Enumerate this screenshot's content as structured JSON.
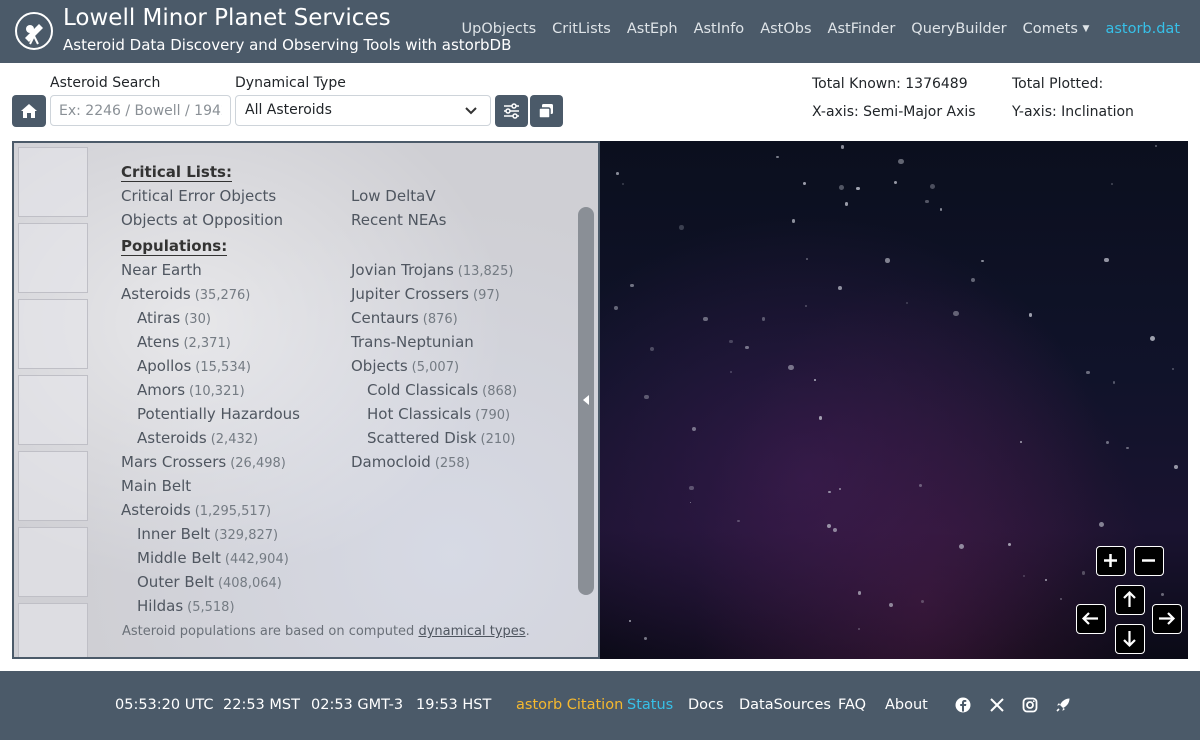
{
  "header": {
    "title": "Lowell Minor Planet Services",
    "subtitle": "Asteroid Data Discovery and Observing Tools with astorbDB",
    "logo_icon": "telescope-logo-icon",
    "nav": [
      "UpObjects",
      "CritLists",
      "AstEph",
      "AstInfo",
      "AstObs",
      "AstFinder",
      "QueryBuilder",
      "Comets"
    ],
    "active_nav": "astorb.dat",
    "accent_color": "#37c0e8",
    "bar_color": "#4b5a69"
  },
  "controls": {
    "search_label": "Asteroid Search",
    "search_placeholder": "Ex: 2246 / Bowell / 1942 CD",
    "dyn_label": "Dynamical Type",
    "dyn_value": "All Asteroids"
  },
  "stats": {
    "total_known": "Total Known: 1376489",
    "total_plotted": "Total Plotted:",
    "x_axis": "X-axis: Semi-Major Axis",
    "y_axis": "Y-axis: Inclination"
  },
  "panel": {
    "critical_heading": "Critical Lists:",
    "critical_left": [
      "Critical Error Objects",
      "Objects at Opposition"
    ],
    "critical_right": [
      "Low DeltaV",
      "Recent NEAs"
    ],
    "populations_heading": "Populations:",
    "pops_left": [
      {
        "name": "Near Earth",
        "count": ""
      },
      {
        "name": "Asteroids",
        "count": "(35,276)"
      },
      {
        "name": "Atiras",
        "count": "(30)"
      },
      {
        "name": "Atens",
        "count": "(2,371)"
      },
      {
        "name": "Apollos",
        "count": "(15,534)"
      },
      {
        "name": "Amors",
        "count": "(10,321)"
      },
      {
        "name": "Potentially Hazardous",
        "count": ""
      },
      {
        "name": "Asteroids",
        "count": "(2,432)"
      },
      {
        "name": "Mars Crossers",
        "count": "(26,498)"
      },
      {
        "name": "Main Belt",
        "count": ""
      },
      {
        "name": "Asteroids",
        "count": "(1,295,517)"
      },
      {
        "name": "Inner Belt",
        "count": "(329,827)"
      },
      {
        "name": "Middle Belt",
        "count": "(442,904)"
      },
      {
        "name": "Outer Belt",
        "count": "(408,064)"
      },
      {
        "name": "Hildas",
        "count": "(5,518)"
      }
    ],
    "pops_right": [
      {
        "name": "Jovian Trojans",
        "count": "(13,825)"
      },
      {
        "name": "Jupiter Crossers",
        "count": "(97)"
      },
      {
        "name": "Centaurs",
        "count": "(876)"
      },
      {
        "name": "Trans-Neptunian",
        "count": ""
      },
      {
        "name": "Objects",
        "count": "(5,007)"
      },
      {
        "name": "Cold Classicals",
        "count": "(868)"
      },
      {
        "name": "Hot Classicals",
        "count": "(790)"
      },
      {
        "name": "Scattered Disk",
        "count": "(210)"
      },
      {
        "name": "Damocloid",
        "count": "(258)"
      }
    ],
    "footnote_pre": "Asteroid populations are based on computed ",
    "footnote_link": "dynamical types",
    "footnote_post": "."
  },
  "footer": {
    "times": [
      "05:53:20 UTC",
      "22:53 MST",
      "02:53 GMT-3",
      "19:53 HST"
    ],
    "citation": "astorb Citation",
    "citation_color": "#f5b82e",
    "status": "Status",
    "links": [
      "Docs",
      "DataSources",
      "FAQ",
      "About"
    ],
    "social_icons": [
      "facebook-icon",
      "x-icon",
      "instagram-icon",
      "rocket-icon"
    ]
  }
}
